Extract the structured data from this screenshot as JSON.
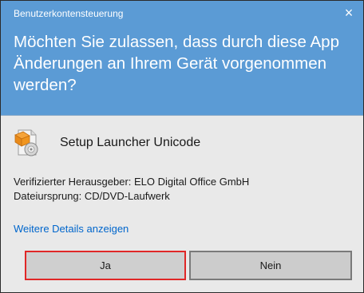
{
  "dialog": {
    "title": "Benutzerkontensteuerung",
    "close_glyph": "×",
    "question": "Möchten Sie zulassen, dass durch diese App Änderungen an Ihrem Gerät vorgenommen werden?",
    "app_name": "Setup Launcher Unicode",
    "publisher_line": "Verifizierter Herausgeber: ELO Digital Office GmbH",
    "origin_line": "Dateiursprung: CD/DVD-Laufwerk",
    "details_link": "Weitere Details anzeigen",
    "buttons": {
      "yes": "Ja",
      "no": "Nein"
    }
  },
  "icons": {
    "close": "close-icon",
    "app": "setup-installer-icon"
  },
  "colors": {
    "header_bg": "#5b9bd5",
    "body_bg": "#e9e9e9",
    "link": "#0066cc",
    "highlight_border": "#e02727"
  }
}
